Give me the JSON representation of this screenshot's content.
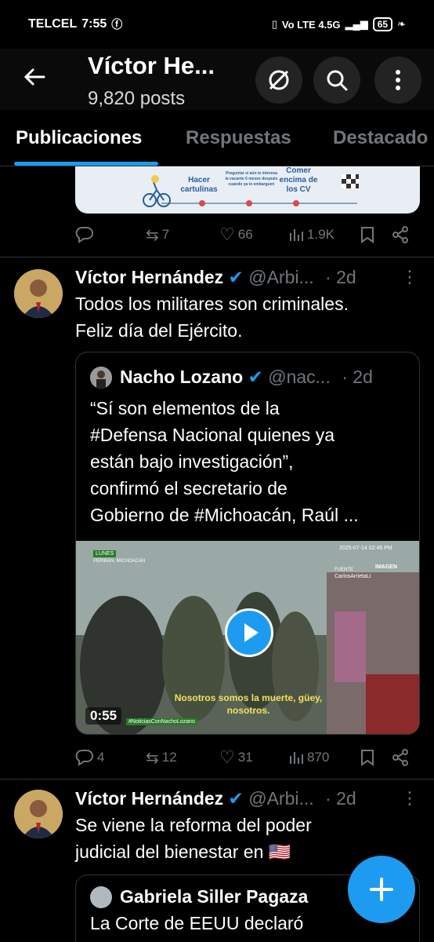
{
  "status_bar": {
    "carrier": "TELCEL",
    "time": "7:55",
    "network": "Vo LTE 4.5G",
    "battery": "65"
  },
  "header": {
    "title": "Víctor He...",
    "posts_count": "9,820 posts"
  },
  "tabs": [
    {
      "label": "Publicaciones",
      "active": true
    },
    {
      "label": "Respuestas",
      "active": false
    },
    {
      "label": "Destacado",
      "active": false
    }
  ],
  "card_image": {
    "labels": [
      "Hacer cartulinas",
      "Preguntar si aún te interesa la vacante 6 meses después cuando ya te embarguen",
      "Comer encima de los CV"
    ]
  },
  "tweet0_actions": {
    "replies": "",
    "retweets": "7",
    "likes": "66",
    "views": "1.9K"
  },
  "tweet1": {
    "name": "Víctor Hernández",
    "handle": "@Arbi...",
    "time": "· 2d",
    "text_lines": [
      "Todos los militares son criminales.",
      "Feliz día del Ejército."
    ],
    "quote": {
      "name": "Nacho Lozano",
      "handle": "@nac...",
      "time": "· 2d",
      "text_lines": [
        "“Sí son elementos de la",
        "#Defensa Nacional quienes ya",
        "están bajo investigación”,",
        "confirmó el secretario de",
        "Gobierno de #Michoacán, Raúl ..."
      ],
      "video": {
        "duration": "0:55",
        "subtitle_1": "Nosotros somos la muerte, güey,",
        "subtitle_2": "nosotros.",
        "tag_day": "LUNES",
        "tag_place": "PERIBÁN, MICHOACÁN",
        "source_label": "FUENTE",
        "source_name": "CarlosArrietaLi",
        "timestamp": "2025-07-14 02:45 PM",
        "brand": "IMAGEN",
        "hashtag": "#NoticiasConNachoLozano"
      }
    },
    "actions": {
      "replies": "4",
      "retweets": "12",
      "likes": "31",
      "views": "870"
    }
  },
  "tweet2": {
    "name": "Víctor Hernández",
    "handle": "@Arbi...",
    "time": "· 2d",
    "text_lines": [
      "Se viene la reforma del poder",
      "judicial del bienestar en 🇺🇸"
    ],
    "quote": {
      "name": "Gabriela Siller Pagaza",
      "text": "La Corte de EEUU declaró"
    }
  },
  "fab": {
    "icon": "plus"
  },
  "colors": {
    "accent": "#1d9bf0",
    "background": "#000000",
    "muted": "#71767b",
    "border": "#2f3336"
  }
}
